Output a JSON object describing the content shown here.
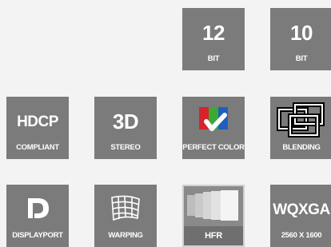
{
  "tiles": {
    "bit12": {
      "value": "12",
      "label": "BIT"
    },
    "bit10": {
      "value": "10",
      "label": "BIT"
    },
    "hdcp": {
      "value": "HDCP",
      "label": "COMPLIANT"
    },
    "stereo": {
      "value": "3D",
      "label": "STEREO"
    },
    "perfect_color": {
      "label": "PERFECT COLOR",
      "icon": "color-check-icon"
    },
    "blending": {
      "label": "BLENDING",
      "icon": "blending-icon"
    },
    "displayport": {
      "label": "DISPLAYPORT",
      "icon": "displayport-icon"
    },
    "warping": {
      "label": "WARPING",
      "icon": "warping-grid-icon"
    },
    "hfr": {
      "label": "HFR",
      "icon": "hfr-frames-icon"
    },
    "wqxga": {
      "value": "WQXGA",
      "label": "2560 X 1600"
    }
  },
  "colors": {
    "tile": "#7b7b7b",
    "background": "#f3f3f4",
    "text": "#ffffff"
  }
}
